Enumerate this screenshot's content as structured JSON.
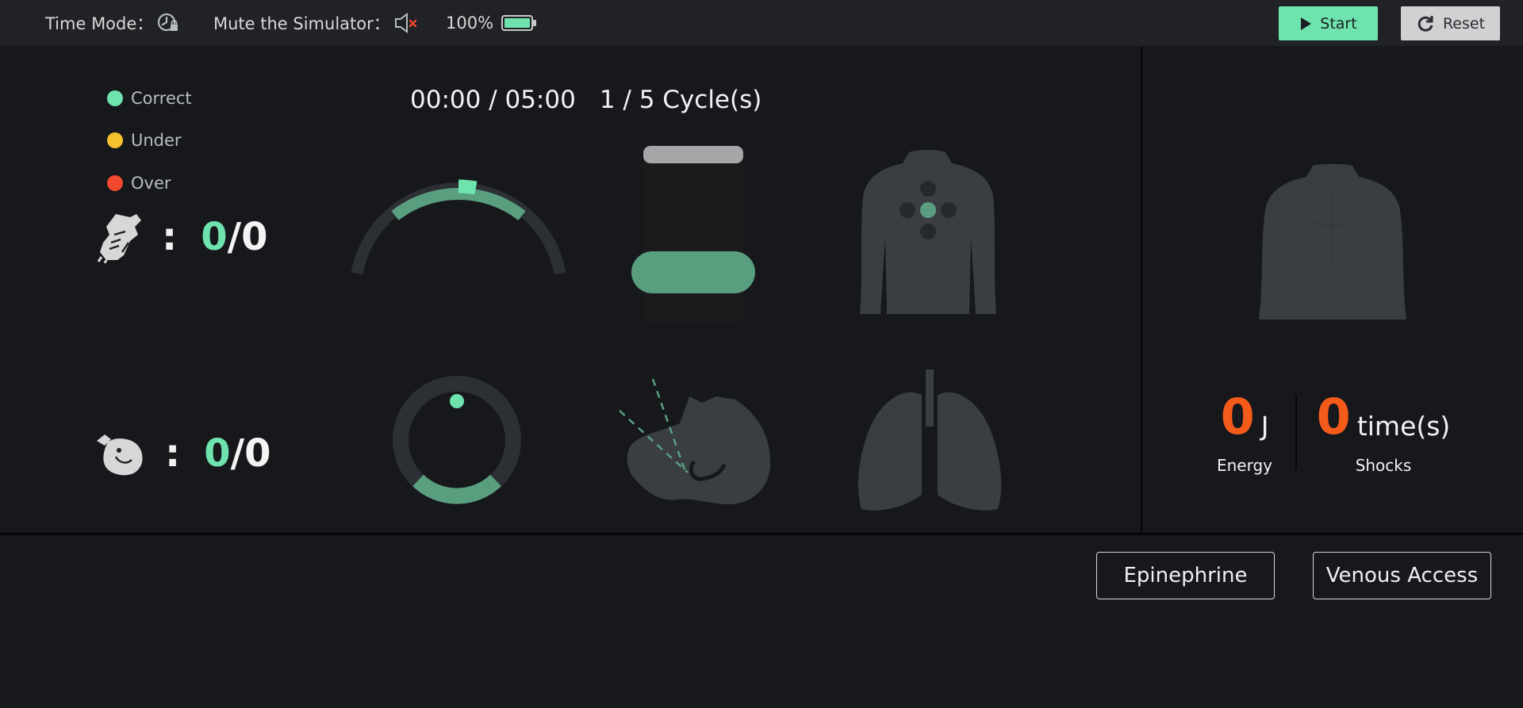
{
  "topbar": {
    "time_mode_label": "Time Mode：",
    "mute_label": "Mute the Simulator：",
    "battery_percent": "100%",
    "start_label": "Start",
    "reset_label": "Reset"
  },
  "legend": {
    "correct": "Correct",
    "under": "Under",
    "over": "Over"
  },
  "colors": {
    "correct": "#6fe3ad",
    "under": "#f5c12e",
    "over": "#f0492e",
    "energy": "#f45a1a",
    "gauge_green": "#5a9e80",
    "body_gray": "#3a3d42"
  },
  "compressions": {
    "colon": ":",
    "correct": "0",
    "total": "/0"
  },
  "ventilations": {
    "colon": ":",
    "correct": "0",
    "total": "/0"
  },
  "timer": {
    "time": "00:00 / 05:00",
    "cycles": "1 / 5 Cycle(s)"
  },
  "defib": {
    "energy_value": "0",
    "energy_unit": "J",
    "energy_label": "Energy",
    "shocks_value": "0",
    "shocks_unit": "time(s)",
    "shocks_label": "Shocks"
  },
  "actions": {
    "epinephrine": "Epinephrine",
    "venous_access": "Venous Access"
  }
}
